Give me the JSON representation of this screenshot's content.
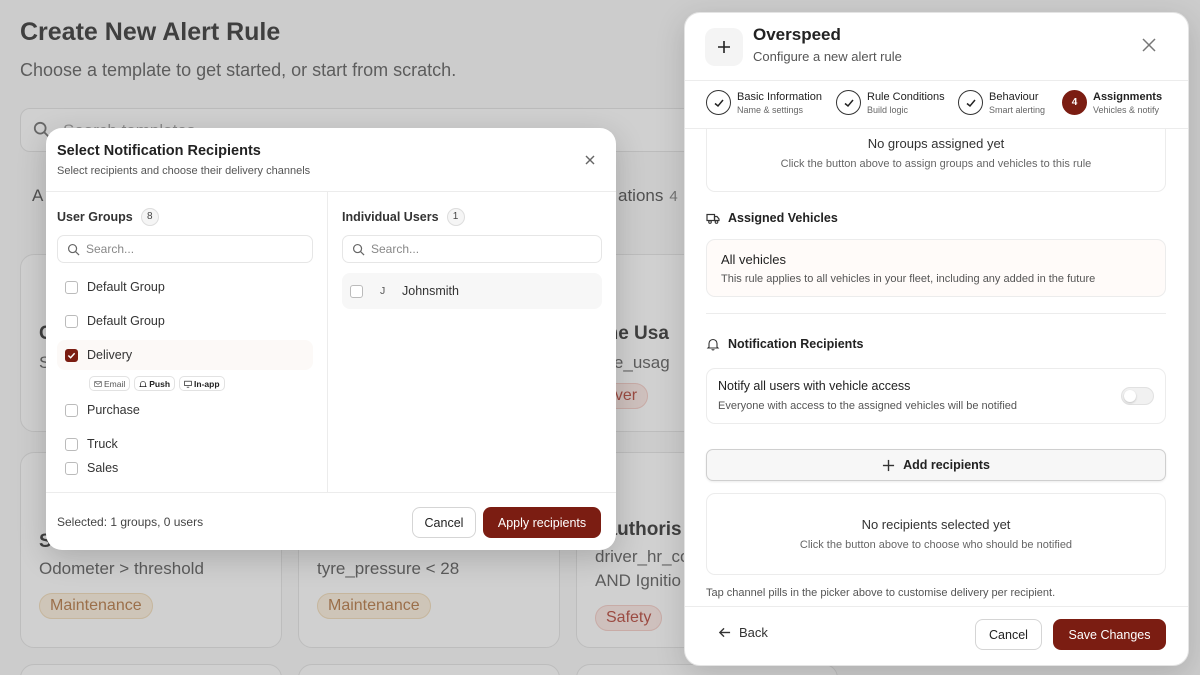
{
  "background": {
    "title": "Create New Alert Rule",
    "subtitle": "Choose a template to get started, or start from scratch.",
    "search_placeholder": "Search templates...",
    "tab_a_initial": "A",
    "tab_label": "ations",
    "tab_count": "4",
    "cards": [
      {
        "title": "C",
        "cond": "S",
        "tag": ""
      },
      {
        "title": "one Usa",
        "cond": "one_usag",
        "tag": "river"
      },
      {
        "title": "S",
        "cond": "Odometer > threshold",
        "tag": "Maintenance"
      },
      {
        "title": "",
        "cond": "tyre_pressure < 28",
        "tag": "Maintenance"
      },
      {
        "title": "nauthoris",
        "cond": "driver_hr_co",
        "cond2": "AND Ignitio",
        "tag": "Safety"
      }
    ]
  },
  "recipients_modal": {
    "title": "Select Notification Recipients",
    "subtitle": "Select recipients and choose their delivery channels",
    "groups": {
      "header": "User Groups",
      "count": "8",
      "search_placeholder": "Search...",
      "items": [
        {
          "label": "Default Group",
          "checked": false
        },
        {
          "label": "Default Group",
          "checked": false
        },
        {
          "label": "Delivery",
          "checked": true
        },
        {
          "label": "Purchase",
          "checked": false
        },
        {
          "label": "Truck",
          "checked": false
        },
        {
          "label": "Sales",
          "checked": false
        }
      ],
      "channels": [
        {
          "label": "Email",
          "icon": "mail-icon",
          "active": false
        },
        {
          "label": "Push",
          "icon": "bell-icon",
          "active": true
        },
        {
          "label": "In-app",
          "icon": "monitor-icon",
          "active": true
        }
      ]
    },
    "users": {
      "header": "Individual Users",
      "count": "1",
      "search_placeholder": "Search...",
      "items": [
        {
          "initial": "J",
          "name": "Johnsmith",
          "checked": false
        }
      ]
    },
    "summary": "Selected: 1 groups, 0 users",
    "cancel_label": "Cancel",
    "apply_label": "Apply recipients"
  },
  "panel": {
    "title": "Overspeed",
    "subtitle": "Configure a new alert rule",
    "steps": [
      {
        "title": "Basic Information",
        "sub": "Name & settings",
        "status": "done"
      },
      {
        "title": "Rule Conditions",
        "sub": "Build logic",
        "status": "done"
      },
      {
        "title": "Behaviour",
        "sub": "Smart alerting",
        "status": "done"
      },
      {
        "title": "Assignments",
        "sub": "Vehicles & notify",
        "status": "active",
        "number": "4"
      }
    ],
    "groups_empty_title": "No groups assigned yet",
    "groups_empty_sub": "Click the button above to assign groups and vehicles to this rule",
    "vehicles_title": "Assigned Vehicles",
    "vehicles_box_title": "All vehicles",
    "vehicles_box_sub": "This rule applies to all vehicles in your fleet, including any added in the future",
    "recipients_title": "Notification Recipients",
    "notify_all_title": "Notify all users with vehicle access",
    "notify_all_sub": "Everyone with access to the assigned vehicles will be notified",
    "notify_all_enabled": false,
    "add_recipients_label": "Add recipients",
    "recipients_empty_title": "No recipients selected yet",
    "recipients_empty_sub": "Click the button above to choose who should be notified",
    "hint": "Tap channel pills in the picker above to customise delivery per recipient.",
    "back_label": "Back",
    "cancel_label": "Cancel",
    "save_label": "Save Changes"
  },
  "colors": {
    "primary": "#7b1d12",
    "overlay": "rgba(110,110,110,0.32)"
  }
}
